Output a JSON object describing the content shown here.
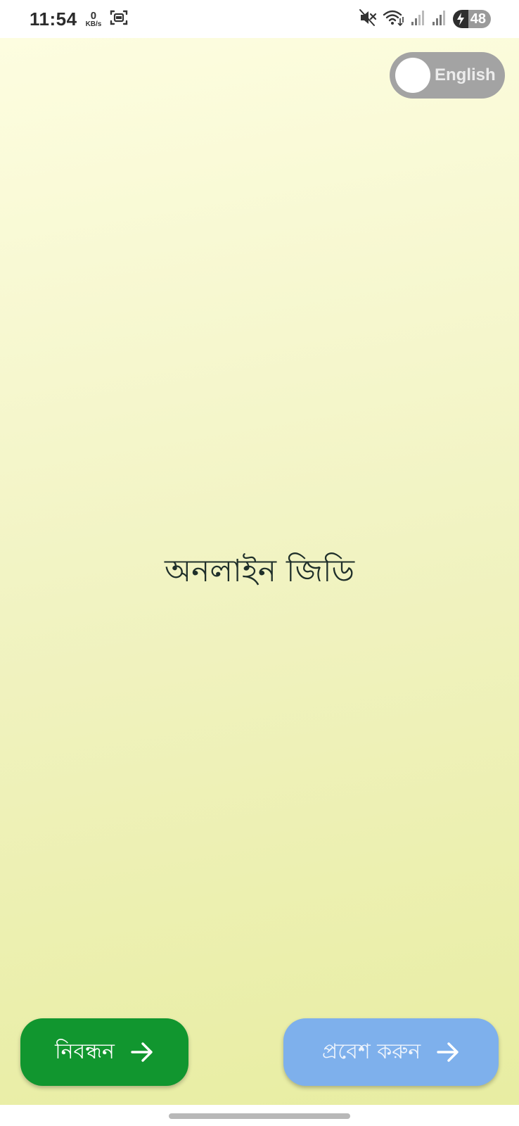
{
  "status_bar": {
    "time": "11:54",
    "net_speed_value": "0",
    "net_speed_unit": "KB/s",
    "battery_level": "48",
    "icons": [
      "screenshot-icon",
      "mute-icon",
      "wifi-icon",
      "signal-icon-1",
      "signal-icon-2",
      "battery-charging-icon"
    ]
  },
  "language_toggle": {
    "label": "English",
    "enabled": false
  },
  "app": {
    "title": "অনলাইন জিডি"
  },
  "actions": {
    "register_label": "নিবন্ধন",
    "login_label": "প্রবেশ করুন"
  },
  "colors": {
    "register_button": "#11962f",
    "login_button": "#7eb0ec",
    "toggle_track": "#a3a3a3",
    "background_top": "#fdfde0",
    "background_bottom": "#e8eda2"
  }
}
